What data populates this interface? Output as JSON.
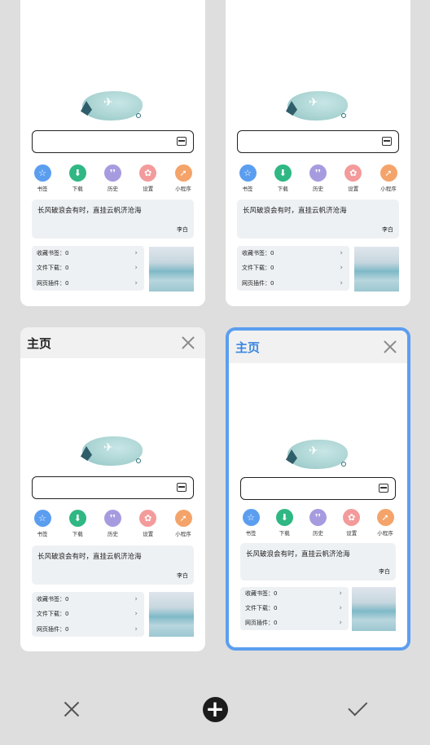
{
  "tabs": [
    {
      "title": "",
      "active": false
    },
    {
      "title": "",
      "active": false
    },
    {
      "title": "主页",
      "active": false
    },
    {
      "title": "主页",
      "active": true
    }
  ],
  "quick_links": [
    {
      "label": "书签",
      "icon": "star-icon",
      "glyph": "☆",
      "color": "#5b9ef0"
    },
    {
      "label": "下载",
      "icon": "download-icon",
      "glyph": "⬇",
      "color": "#2fb784"
    },
    {
      "label": "历史",
      "icon": "footprints-icon",
      "glyph": "❜❜",
      "color": "#a79be0"
    },
    {
      "label": "设置",
      "icon": "gear-icon",
      "glyph": "✿",
      "color": "#f39b9b"
    },
    {
      "label": "小程序",
      "icon": "mini-program-icon",
      "glyph": "➚",
      "color": "#f4a46a"
    }
  ],
  "quote": {
    "text": "长风破浪会有时，直挂云帆济沧海",
    "author": "李白"
  },
  "stats": [
    {
      "label": "收藏书签：0"
    },
    {
      "label": "文件下载：0"
    },
    {
      "label": "网页插件：0"
    }
  ],
  "bottom_bar": {
    "close": "close-all",
    "add": "new-tab",
    "done": "confirm"
  }
}
